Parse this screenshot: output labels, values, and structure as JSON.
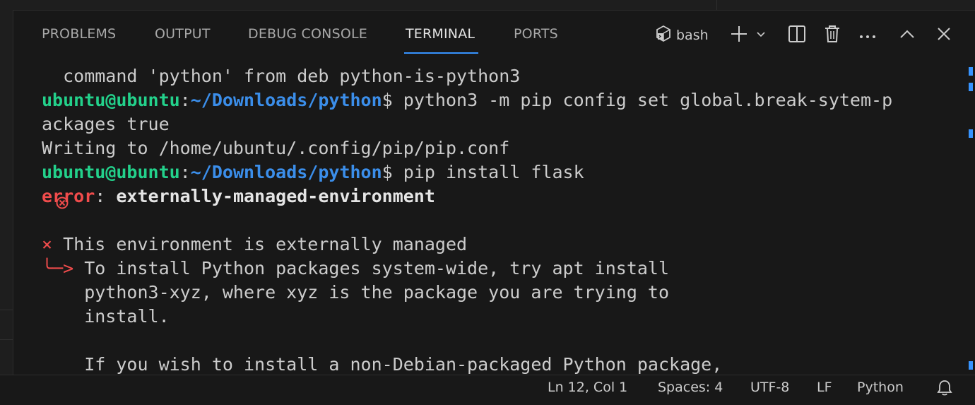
{
  "panel": {
    "tabs": [
      {
        "label": "PROBLEMS"
      },
      {
        "label": "OUTPUT"
      },
      {
        "label": "DEBUG CONSOLE"
      },
      {
        "label": "TERMINAL",
        "active": true
      },
      {
        "label": "PORTS"
      }
    ],
    "actions": {
      "shell_label": "bash",
      "icons": [
        "terminal-icon",
        "plus-icon",
        "chevron-down-icon",
        "split-icon",
        "trash-icon",
        "ellipsis-icon",
        "chevron-up-icon",
        "close-icon"
      ]
    }
  },
  "terminal": {
    "lines": {
      "l0": "  command 'python' from deb python-is-python3",
      "l1_user": "ubuntu@ubuntu",
      "l1_colon": ":",
      "l1_path": "~/Downloads/python",
      "l1_cmd": "$ python3 -m pip config set global.break-sytem-p",
      "l2": "ackages true",
      "l3": "Writing to /home/ubuntu/.config/pip/pip.conf",
      "l4_user": "ubuntu@ubuntu",
      "l4_colon": ":",
      "l4_path": "~/Downloads/python",
      "l4_cmd": "$ pip install flask",
      "l5_err": "error",
      "l5_colon": ": ",
      "l5_msg": "externally-managed-environment",
      "l7_x": "×",
      "l7_text": " This environment is externally managed",
      "l8_arrow": "╰─>",
      "l8_text": " To install Python packages system-wide, try apt install",
      "l9": "    python3-xyz, where xyz is the package you are trying to",
      "l10": "    install.",
      "l12": "    If you wish to install a non-Debian-packaged Python package,"
    },
    "decorations": {
      "success_color": "#3794ff",
      "error_color": "#f14c4c"
    }
  },
  "statusbar": {
    "position": "Ln 12, Col 1",
    "spaces": "Spaces: 4",
    "encoding": "UTF-8",
    "eol": "LF",
    "language": "Python",
    "bell_icon": "bell-icon"
  }
}
